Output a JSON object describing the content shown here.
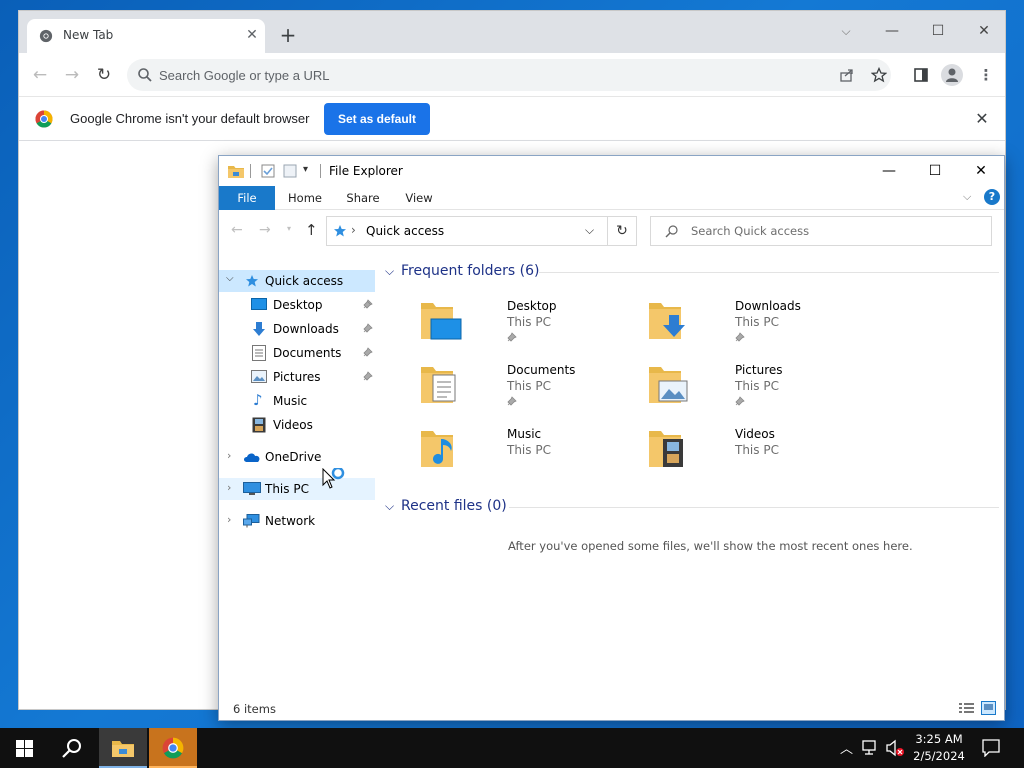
{
  "chrome": {
    "tab_title": "New Tab",
    "omnibox_placeholder": "Search Google or type a URL",
    "infobar_message": "Google Chrome isn't your default browser",
    "set_default_label": "Set as default"
  },
  "explorer": {
    "title": "File Explorer",
    "ribbon_tabs": [
      "File",
      "Home",
      "Share",
      "View"
    ],
    "address_location": "Quick access",
    "search_placeholder": "Search Quick access",
    "nav": {
      "quick_access": "Quick access",
      "desktop": "Desktop",
      "downloads": "Downloads",
      "documents": "Documents",
      "pictures": "Pictures",
      "music": "Music",
      "videos": "Videos",
      "onedrive": "OneDrive",
      "this_pc": "This PC",
      "network": "Network"
    },
    "frequent_header": "Frequent folders (6)",
    "folders": [
      {
        "name": "Desktop",
        "location": "This PC",
        "pinned": true
      },
      {
        "name": "Downloads",
        "location": "This PC",
        "pinned": true
      },
      {
        "name": "Documents",
        "location": "This PC",
        "pinned": true
      },
      {
        "name": "Pictures",
        "location": "This PC",
        "pinned": true
      },
      {
        "name": "Music",
        "location": "This PC",
        "pinned": false
      },
      {
        "name": "Videos",
        "location": "This PC",
        "pinned": false
      }
    ],
    "recent_header": "Recent files (0)",
    "recent_empty_message": "After you've opened some files, we'll show the most recent ones here.",
    "status_items": "6 items"
  },
  "taskbar": {
    "time": "3:25 AM",
    "date": "2/5/2024"
  },
  "colors": {
    "accent_blue": "#1a73e8",
    "explorer_file_tab": "#1979ca",
    "folder_yellow": "#f4c76a",
    "selection": "#cce8ff"
  }
}
